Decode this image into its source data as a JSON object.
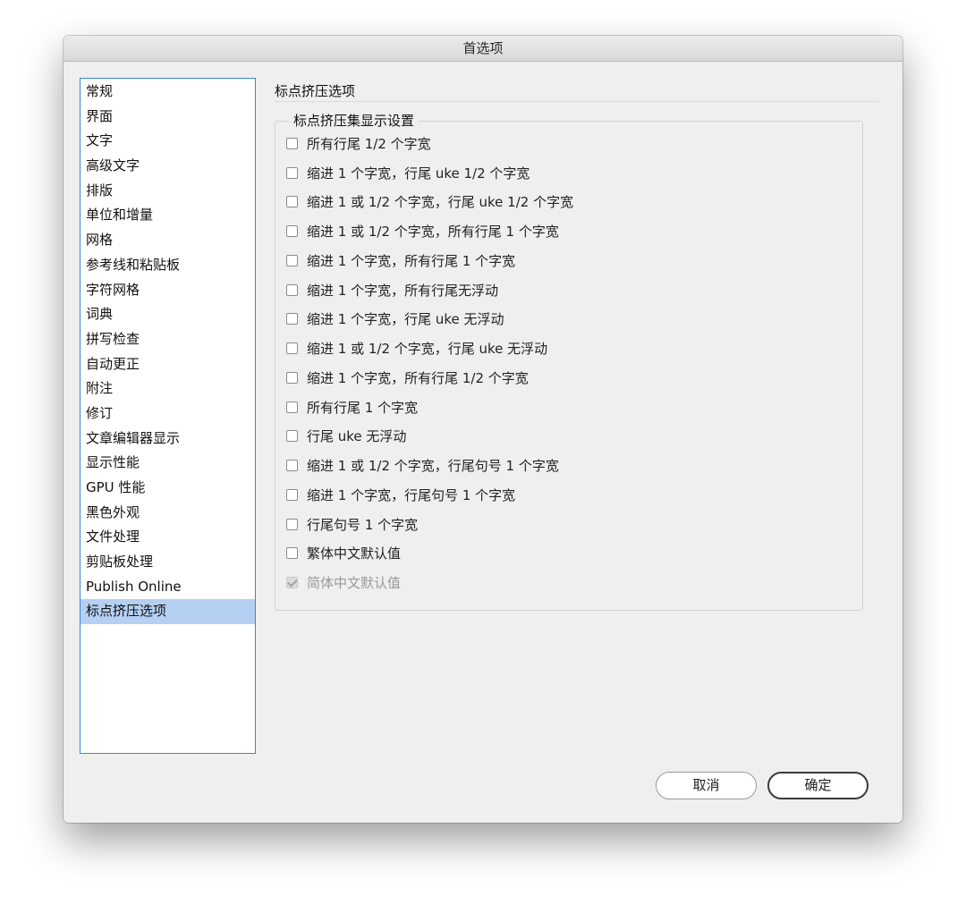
{
  "window": {
    "title": "首选项"
  },
  "sidebar": {
    "items": [
      {
        "label": "常规"
      },
      {
        "label": "界面"
      },
      {
        "label": "文字"
      },
      {
        "label": "高级文字"
      },
      {
        "label": "排版"
      },
      {
        "label": "单位和增量"
      },
      {
        "label": "网格"
      },
      {
        "label": "参考线和粘贴板"
      },
      {
        "label": "字符网格"
      },
      {
        "label": "词典"
      },
      {
        "label": "拼写检查"
      },
      {
        "label": "自动更正"
      },
      {
        "label": "附注"
      },
      {
        "label": "修订"
      },
      {
        "label": "文章编辑器显示"
      },
      {
        "label": "显示性能"
      },
      {
        "label": "GPU 性能"
      },
      {
        "label": "黑色外观"
      },
      {
        "label": "文件处理"
      },
      {
        "label": "剪贴板处理"
      },
      {
        "label": "Publish Online"
      },
      {
        "label": "标点挤压选项"
      }
    ],
    "selected_index": 21,
    "selection_color": "#b5d0f2",
    "border_color": "#3b86d8"
  },
  "panel": {
    "title": "标点挤压选项",
    "group_title": "标点挤压集显示设置",
    "options": [
      {
        "label": "所有行尾 1/2 个字宽",
        "checked": false,
        "enabled": true
      },
      {
        "label": "缩进 1 个字宽，行尾 uke 1/2 个字宽",
        "checked": false,
        "enabled": true
      },
      {
        "label": "缩进 1 或 1/2 个字宽，行尾 uke 1/2 个字宽",
        "checked": false,
        "enabled": true
      },
      {
        "label": "缩进 1 或 1/2 个字宽，所有行尾 1 个字宽",
        "checked": false,
        "enabled": true
      },
      {
        "label": "缩进 1 个字宽，所有行尾 1 个字宽",
        "checked": false,
        "enabled": true
      },
      {
        "label": "缩进 1 个字宽，所有行尾无浮动",
        "checked": false,
        "enabled": true
      },
      {
        "label": "缩进 1 个字宽，行尾 uke 无浮动",
        "checked": false,
        "enabled": true
      },
      {
        "label": "缩进 1 或 1/2 个字宽，行尾 uke 无浮动",
        "checked": false,
        "enabled": true
      },
      {
        "label": "缩进 1 个字宽，所有行尾 1/2 个字宽",
        "checked": false,
        "enabled": true
      },
      {
        "label": "所有行尾 1 个字宽",
        "checked": false,
        "enabled": true
      },
      {
        "label": "行尾 uke 无浮动",
        "checked": false,
        "enabled": true
      },
      {
        "label": "缩进 1 或 1/2 个字宽，行尾句号 1 个字宽",
        "checked": false,
        "enabled": true
      },
      {
        "label": "缩进 1 个字宽，行尾句号 1 个字宽",
        "checked": false,
        "enabled": true
      },
      {
        "label": "行尾句号 1 个字宽",
        "checked": false,
        "enabled": true
      },
      {
        "label": "繁体中文默认值",
        "checked": false,
        "enabled": true
      },
      {
        "label": "简体中文默认值",
        "checked": true,
        "enabled": false
      }
    ]
  },
  "buttons": {
    "cancel_label": "取消",
    "ok_label": "确定"
  }
}
